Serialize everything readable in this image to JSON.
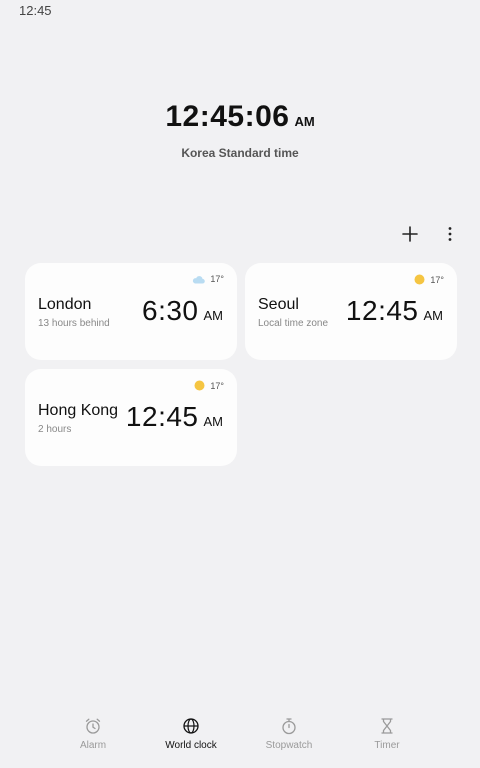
{
  "status_bar": {
    "time": "12:45"
  },
  "hero": {
    "time": "12:45:06",
    "ampm": "AM",
    "zone": "Korea Standard time"
  },
  "toolbar": {
    "add_icon": "plus-icon",
    "menu_icon": "more-vertical-icon"
  },
  "cards": [
    {
      "city": "London",
      "offset": "13 hours behind",
      "time": "6:30",
      "ampm": "AM",
      "temp": "17°",
      "weather_icon": "cloud-icon"
    },
    {
      "city": "Seoul",
      "offset": "Local time zone",
      "time": "12:45",
      "ampm": "AM",
      "temp": "17°",
      "weather_icon": "sun-icon"
    },
    {
      "city": "Hong Kong",
      "offset": "2 hours",
      "time": "12:45",
      "ampm": "AM",
      "temp": "17°",
      "weather_icon": "sun-icon"
    }
  ],
  "nav": {
    "items": [
      {
        "label": "Alarm",
        "icon": "alarm-clock-icon"
      },
      {
        "label": "World clock",
        "icon": "globe-icon",
        "active": true
      },
      {
        "label": "Stopwatch",
        "icon": "stopwatch-icon"
      },
      {
        "label": "Timer",
        "icon": "hourglass-icon"
      }
    ]
  },
  "colors": {
    "background": "#f1f1f3",
    "card": "#fdfdfd",
    "sun": "#f5c542",
    "cloud": "#b9dcf2"
  }
}
